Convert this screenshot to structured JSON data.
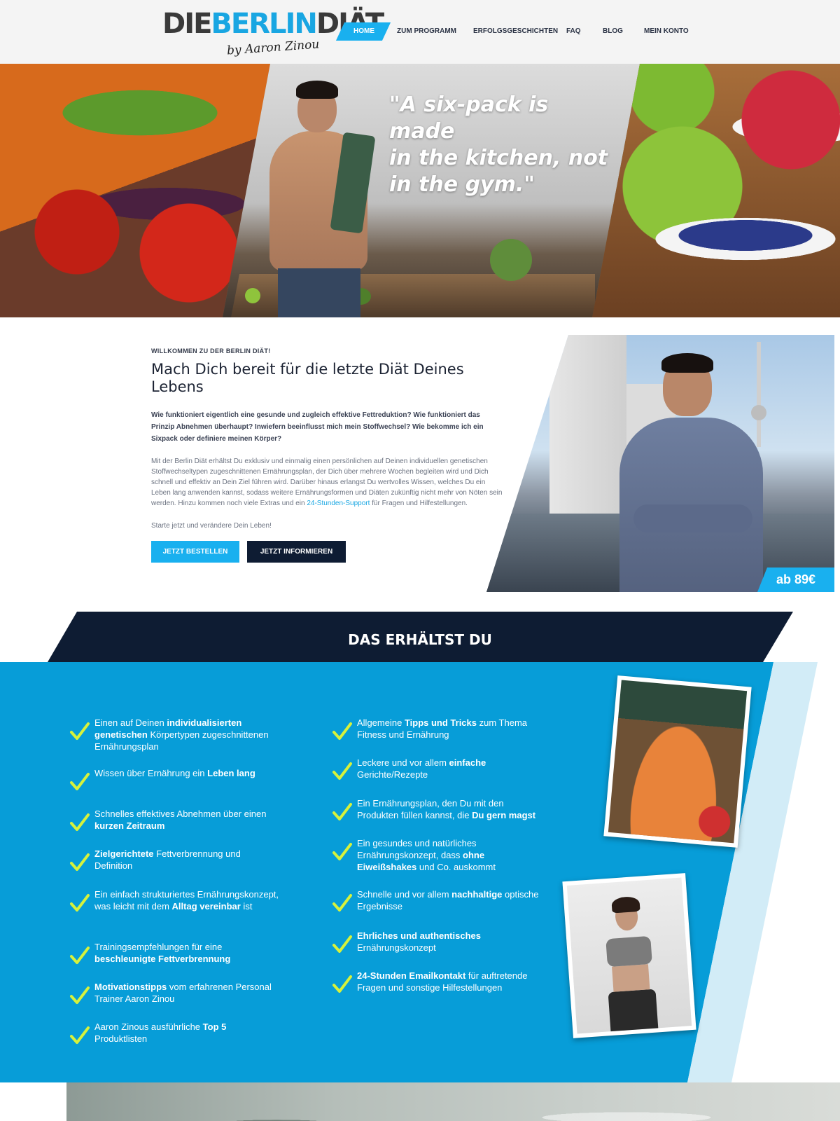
{
  "header": {
    "logo": {
      "part1": "DIE",
      "part2": "BERLIN",
      "part3": "DIÄT",
      "signature": "by Aaron Zinou"
    },
    "nav": [
      {
        "label": "HOME",
        "active": true
      },
      {
        "label": "ZUM PROGRAMM",
        "active": false
      },
      {
        "label": "ERFOLGSGESCHICHTEN",
        "active": false
      },
      {
        "label": "FAQ",
        "active": false
      },
      {
        "label": "BLOG",
        "active": false
      },
      {
        "label": "MEIN KONTO",
        "active": false
      }
    ]
  },
  "hero": {
    "quote_line1": "\"A six-pack is made",
    "quote_line2": "in the kitchen, not",
    "quote_line3": "in the gym.\""
  },
  "welcome": {
    "kicker": "WILLKOMMEN ZU DER BERLIN DIÄT!",
    "title": "Mach Dich bereit für die letzte Diät Deines Lebens",
    "lead": "Wie funktioniert eigentlich eine gesunde und zugleich effektive Fettreduktion? Wie funktioniert das Prinzip Abnehmen überhaupt? Inwiefern beeinflusst mich mein Stoffwechsel? Wie bekomme ich ein Sixpack oder definiere meinen Körper?",
    "body_before_link": "Mit der Berlin Diät erhältst Du exklusiv und einmalig einen persönlichen auf Deinen individuellen genetischen Stoffwechseltypen zugeschnittenen Ernährungsplan, der Dich über mehrere Wochen begleiten wird und Dich schnell und effektiv an Dein Ziel führen wird. Darüber hinaus erlangst Du wertvolles Wissen, welches Du ein Leben lang anwenden kannst, sodass weitere Ernährungsformen und Diäten zukünftig nicht mehr von Nöten sein werden. Hinzu kommen noch viele Extras und ein ",
    "body_link": "24-Stunden-Support",
    "body_after_link": " für Fragen und Hilfestellungen.",
    "start": "Starte jetzt und verändere Dein Leben!",
    "btn_order": "JETZT BESTELLEN",
    "btn_info": "JETZT INFORMIEREN",
    "price": "ab 89€"
  },
  "features": {
    "title": "DAS ERHÄLTST DU",
    "left": [
      {
        "html": "Einen auf Deinen <b>individualisierten genetischen</b> Körpertypen zugeschnittenen Ernährungsplan"
      },
      {
        "html": "Wissen über Ernährung ein <b>Leben lang</b>"
      },
      {
        "html": "Schnelles effektives Abnehmen über einen <b>kurzen Zeitraum</b>"
      },
      {
        "html": "<b>Zielgerichtete</b> Fettverbrennung und Definition"
      },
      {
        "html": "Ein einfach strukturiertes Ernährungskonzept, was leicht mit dem <b>Alltag vereinbar</b> ist"
      },
      {
        "html": "Trainingsempfehlungen für eine <b>beschleunigte Fettverbrennung</b>"
      },
      {
        "html": "<b>Motivationstipps</b> vom erfahrenen Personal Trainer Aaron Zinou"
      },
      {
        "html": "Aaron Zinous ausführliche <b>Top 5</b> Produktlisten"
      }
    ],
    "right": [
      {
        "html": "Allgemeine <b>Tipps und Tricks</b> zum Thema Fitness und Ernährung"
      },
      {
        "html": "Leckere und vor allem <b>einfache</b> Gerichte/Rezepte"
      },
      {
        "html": "Ein Ernährungsplan, den Du mit den Produkten füllen kannst, die <b>Du gern magst</b>"
      },
      {
        "html": "Ein gesundes und natürliches Ernährungskonzept, dass <b>ohne Eiweißshakes</b> und Co. auskommt"
      },
      {
        "html": "Schnelle und vor allem <b>nachhaltige</b> optische Ergebnisse"
      },
      {
        "html": "<b>Ehrliches und authentisches</b> Ernährungskonzept"
      },
      {
        "html": "<b>24-Stunden Emailkontakt</b> für auftretende Fragen und sonstige Hilfestellungen"
      }
    ]
  },
  "colors": {
    "accent": "#19b0ef",
    "navy": "#0e1c33",
    "feature_blue": "#079dd8",
    "check": "#d6f23c"
  }
}
